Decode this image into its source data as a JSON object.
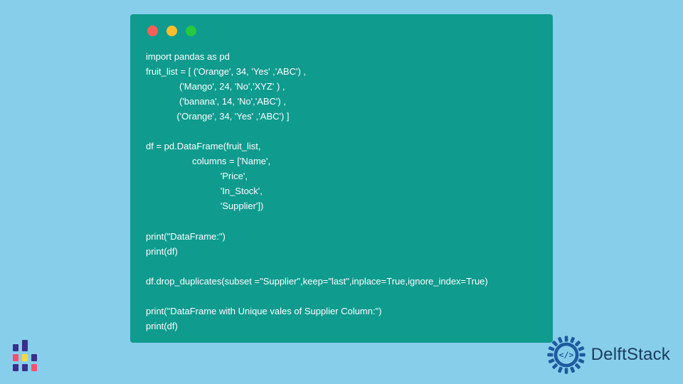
{
  "code": {
    "lines": [
      "import pandas as pd",
      "fruit_list = [ ('Orange', 34, 'Yes' ,'ABC') ,",
      "             ('Mango', 24, 'No','XYZ' ) ,",
      "             ('banana', 14, 'No','ABC') ,",
      "            ('Orange', 34, 'Yes' ,'ABC') ]",
      "",
      "df = pd.DataFrame(fruit_list,",
      "                  columns = ['Name',",
      "                             'Price',",
      "                             'In_Stock',",
      "                             'Supplier'])",
      "",
      "print(\"DataFrame:\")",
      "print(df)",
      "",
      "df.drop_duplicates(subset =\"Supplier\",keep=\"last\",inplace=True,ignore_index=True)",
      "",
      "print(\"DataFrame with Unique vales of Supplier Column:\")",
      "print(df)"
    ]
  },
  "branding": {
    "name": "DelftStack"
  },
  "colors": {
    "page_bg": "#87ceeb",
    "panel_bg": "#0f9b8e",
    "code_fg": "#ffffff",
    "brand_text": "#1a3a5c",
    "brand_gear": "#1e5a9e",
    "dot_red": "#ff5f56",
    "dot_yellow": "#ffbd2e",
    "dot_green": "#27c93f"
  }
}
